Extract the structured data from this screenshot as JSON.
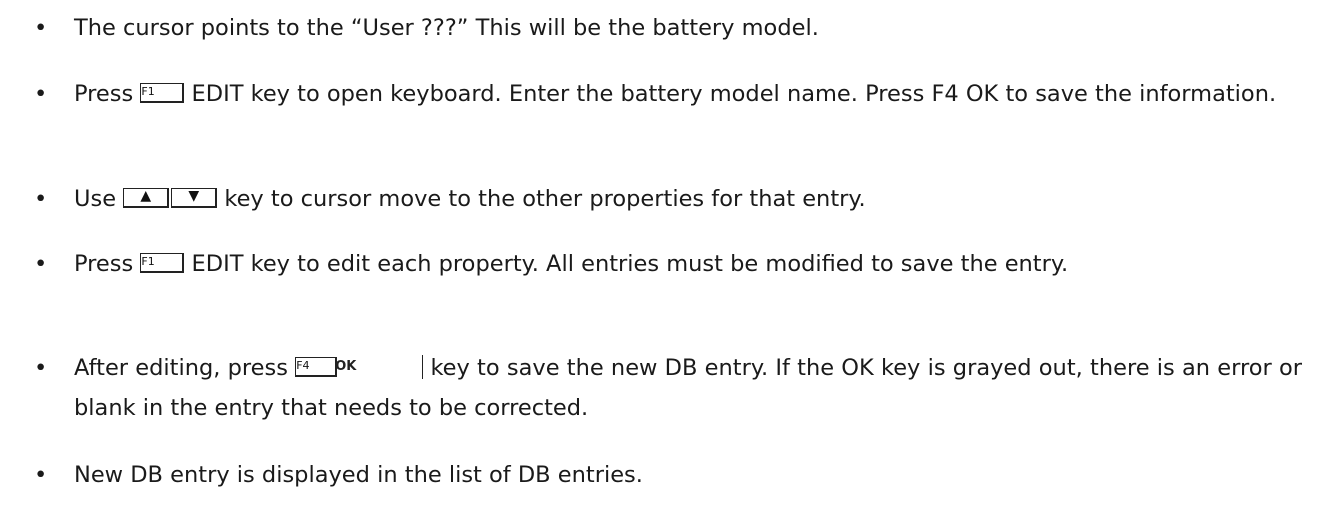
{
  "bullet_symbol": "•",
  "items": [
    {
      "text": "The cursor points to the “User ???” This will be the battery model."
    },
    {
      "before": "Press",
      "key": "F1",
      "after": "EDIT key to open keyboard. Enter the battery model name. Press F4 OK to save the information."
    },
    {
      "before": "Use",
      "keys": [
        "▲",
        "▼"
      ],
      "after": "key to cursor move to the other properties for that entry."
    },
    {
      "before": "Press",
      "key": "F1",
      "after": "EDIT key to edit each property. All entries must be modified to save the entry."
    },
    {
      "before": "After editing, press",
      "key": "F4",
      "key_label": "OK",
      "after": "key to save the new DB entry. If the OK key is grayed out, there is an error or blank in the entry that needs to be corrected."
    },
    {
      "text": "New DB entry is displayed in the list of DB entries."
    }
  ]
}
